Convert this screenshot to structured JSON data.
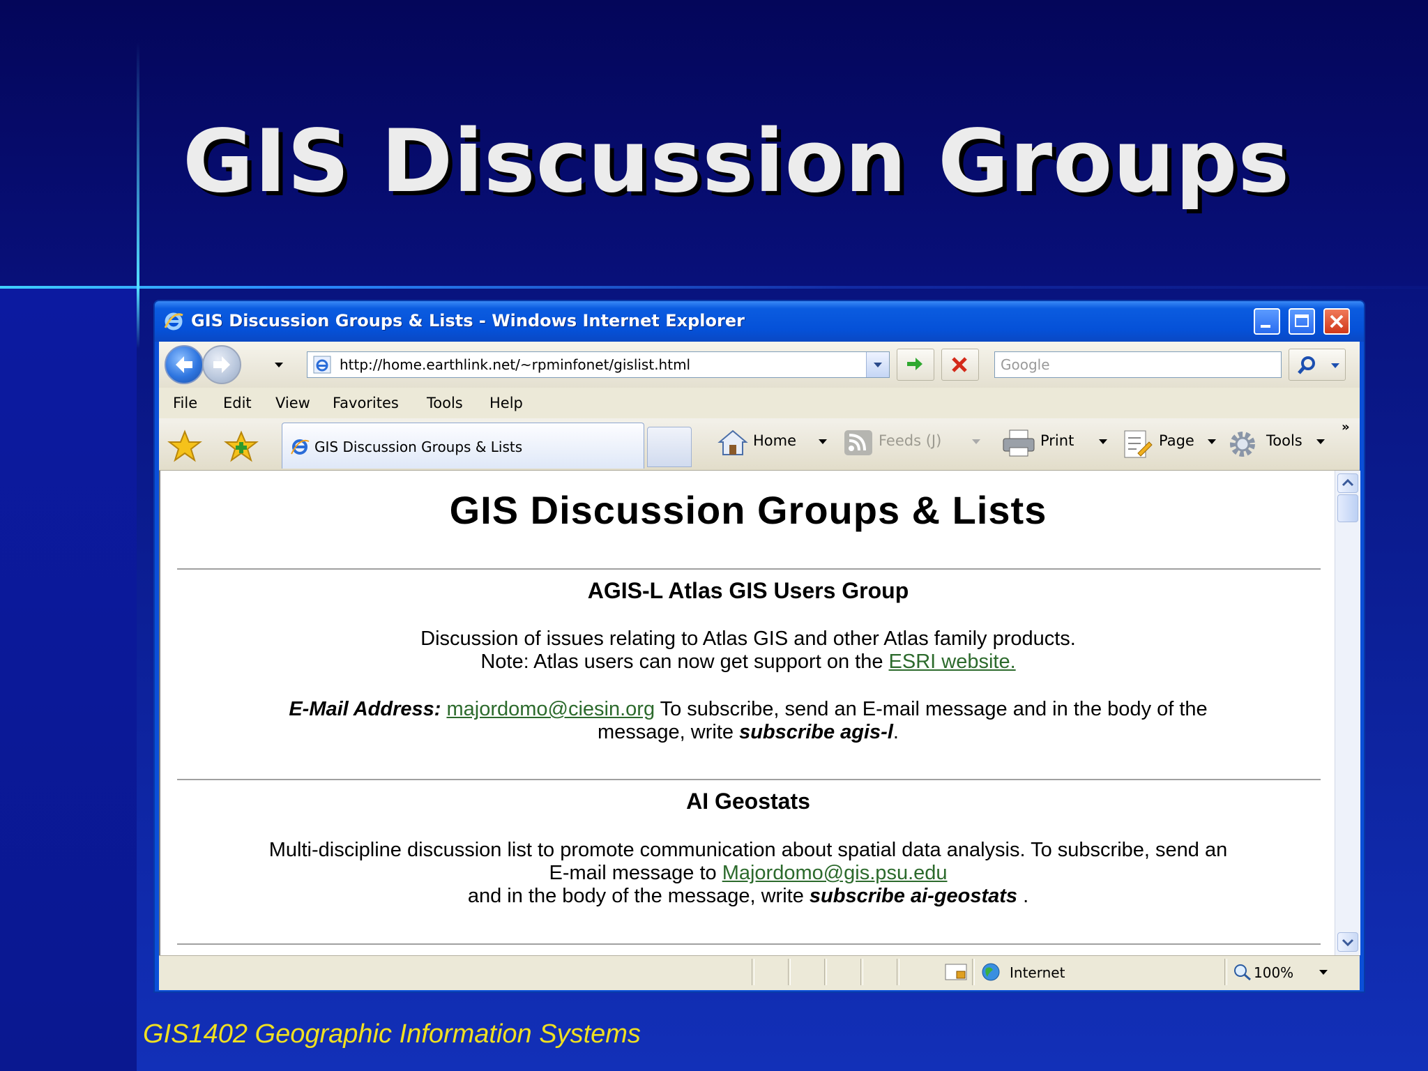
{
  "slide": {
    "title": "GIS Discussion Groups",
    "footer": "GIS1402 Geographic Information Systems"
  },
  "browser": {
    "window_title": "GIS Discussion Groups & Lists - Windows Internet Explorer",
    "address": "http://home.earthlink.net/~rpminfonet/gislist.html",
    "search_placeholder": "Google",
    "menu": [
      "File",
      "Edit",
      "View",
      "Favorites",
      "Tools",
      "Help"
    ],
    "tab_label": "GIS Discussion Groups & Lists",
    "commands": {
      "home": "Home",
      "feeds": "Feeds (J)",
      "print": "Print",
      "page": "Page",
      "tools": "Tools"
    },
    "status": {
      "zone": "Internet",
      "zoom": "100%"
    },
    "icons": [
      "ie-logo-icon",
      "back-icon",
      "forward-icon",
      "refresh-icon",
      "stop-icon",
      "search-icon",
      "favorites-star-icon",
      "add-favorites-icon",
      "home-icon",
      "feeds-icon",
      "print-icon",
      "page-icon",
      "tools-gear-icon",
      "globe-icon",
      "zoom-icon"
    ]
  },
  "page": {
    "heading": "GIS Discussion Groups & Lists",
    "sections": [
      {
        "title": "AGIS-L Atlas GIS Users Group",
        "desc1": "Discussion of issues relating to Atlas GIS and other Atlas family products.",
        "desc2_pre": "Note: Atlas users can now get support on the ",
        "desc2_link": "ESRI website.",
        "email_label": "E-Mail Address:",
        "email": "majordomo@ciesin.org",
        "email_post": " To subscribe, send an E-mail message and in the body of the",
        "line2_pre": "message, write ",
        "cmd": "subscribe agis-l",
        "line2_post": "."
      },
      {
        "title": "AI Geostats",
        "desc1": "Multi-discipline discussion list to promote communication about spatial data analysis. To subscribe, send an",
        "line2_pre": "E-mail message to ",
        "email": "Majordomo@gis.psu.edu",
        "line3_pre": "and in the body of the message, write ",
        "cmd": "subscribe ai-geostats",
        "line3_post": " ."
      }
    ]
  }
}
